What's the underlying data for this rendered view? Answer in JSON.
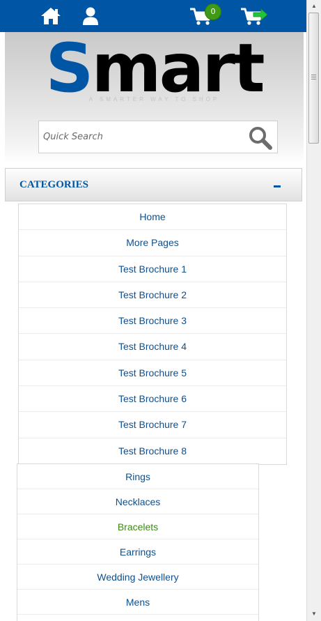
{
  "topbar": {
    "icons": [
      "home-icon",
      "user-icon",
      "cart-icon",
      "checkout-cart-icon"
    ],
    "cart_count": "0",
    "brand_color": "#0055a4",
    "badge_color": "#3f9a16",
    "checkout_arrow_color": "#22c43a"
  },
  "header": {
    "logo_first": "S",
    "logo_rest": "mart",
    "tagline": "A SMARTER WAY TO SHOP"
  },
  "search": {
    "placeholder": "Quick Search",
    "value": "",
    "icon": "search-icon"
  },
  "categories": {
    "title": "CATEGORIES",
    "toggle": "collapse",
    "pages": [
      "Home",
      "More Pages",
      "Test Brochure 1",
      "Test Brochure 2",
      "Test Brochure 3",
      "Test Brochure 4",
      "Test Brochure 5",
      "Test Brochure 6",
      "Test Brochure 7",
      "Test Brochure 8"
    ],
    "products": [
      {
        "label": "Rings",
        "active": false
      },
      {
        "label": "Necklaces",
        "active": false
      },
      {
        "label": "Bracelets",
        "active": true
      },
      {
        "label": "Earrings",
        "active": false
      },
      {
        "label": "Wedding Jewellery",
        "active": false
      },
      {
        "label": "Mens",
        "active": false
      }
    ]
  },
  "colors": {
    "link": "#0e4f8d",
    "active_link": "#3c8a14",
    "heading": "#0055a4"
  }
}
